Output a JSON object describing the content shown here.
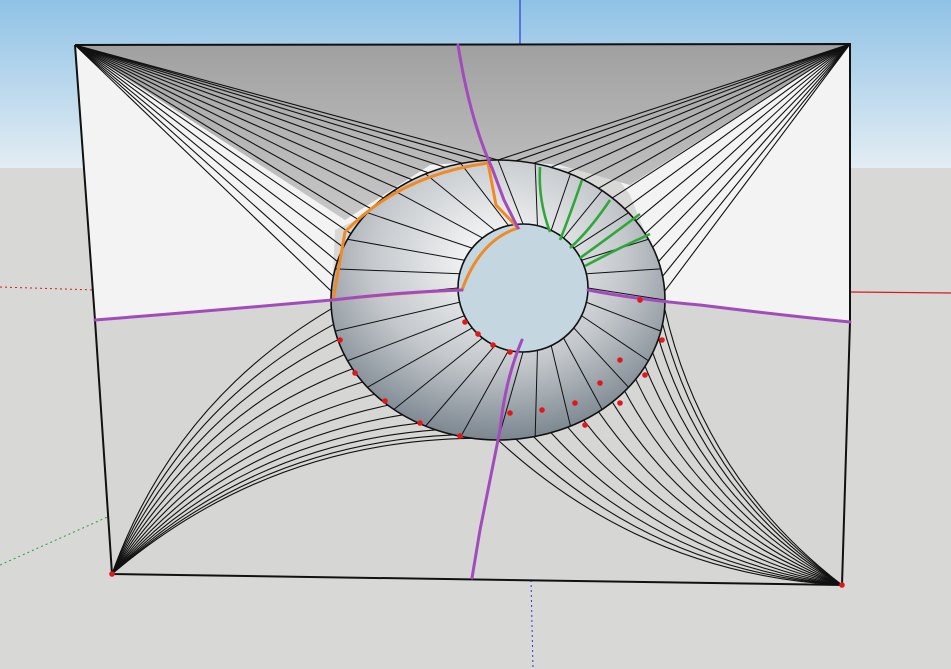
{
  "app": {
    "viewport_label": ""
  },
  "colors": {
    "sky_top": "#98c6e6",
    "sky_bottom": "#dfeaf1",
    "ground": "#d8d8d6",
    "outline": "#111111",
    "face_light": "#f2f2f2",
    "face_top": "#a8a8a8",
    "funnel_dark": "#6e7a84",
    "hole": "#c4d7e1",
    "axis_red": "#d21e1e",
    "axis_green": "#2aa12a",
    "axis_blue": "#2c3cd2",
    "selection_magenta": "#a24bbd",
    "highlight_orange": "#f08a24",
    "highlight_green": "#2fa83a",
    "vertex_red": "#e01818"
  },
  "scene": {
    "description_items": [
      "rectangular-frame",
      "central-funnel-opening",
      "fan-lines-to-corners",
      "selection-curves",
      "model-axes"
    ]
  }
}
